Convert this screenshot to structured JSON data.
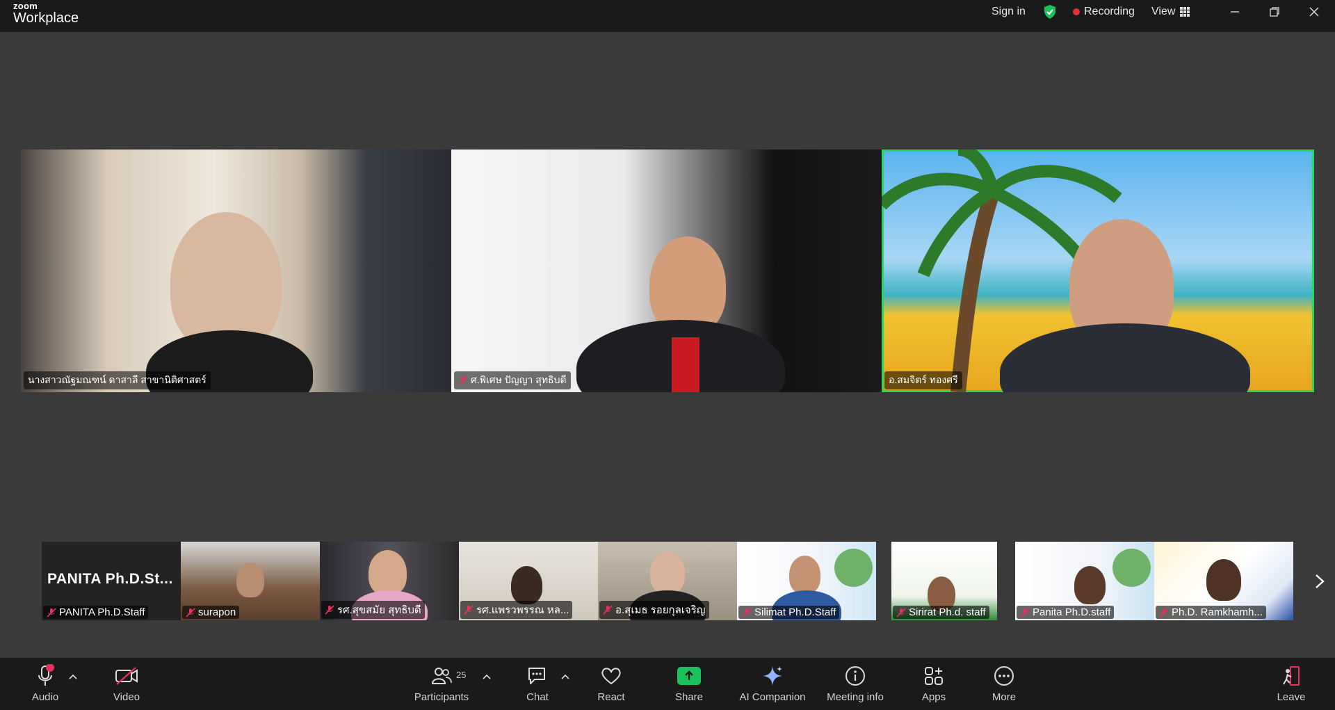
{
  "titlebar": {
    "brand_small": "zoom",
    "brand_big": "Workplace",
    "sign_in": "Sign in",
    "recording": "Recording",
    "view": "View"
  },
  "main_tiles": [
    {
      "name": "นางสาวณัฐมณฑน์ ดาสาลี สาขานิติศาสตร์",
      "muted": false
    },
    {
      "name": "ศ.พิเศษ ปัญญา สุทธิบดี",
      "muted": true
    },
    {
      "name": "อ.สมจิตร์ ทองศรี",
      "muted": false,
      "speaking": true
    }
  ],
  "filmstrip": [
    {
      "name": "PANITA Ph.D.Staff",
      "display_name": "PANITA Ph.D.St..."
    },
    {
      "name": "surapon"
    },
    {
      "name": "รศ.สุขสมัย สุทธิบดี"
    },
    {
      "name": "รศ.แพรวพรรณ หล..."
    },
    {
      "name": "อ.สุเมธ รอยกุลเจริญ"
    },
    {
      "name": "Silimat Ph.D.Staff"
    },
    {
      "name": "Sirirat Ph.d. staff"
    },
    {
      "name": "Panita Ph.D.staff"
    },
    {
      "name": "Ph.D. Ramkhamh..."
    }
  ],
  "toolbar": {
    "audio": "Audio",
    "video": "Video",
    "participants": "Participants",
    "participants_count": "25",
    "chat": "Chat",
    "react": "React",
    "share": "Share",
    "ai_companion": "AI Companion",
    "meeting_info": "Meeting info",
    "apps": "Apps",
    "more": "More",
    "leave": "Leave"
  },
  "colors": {
    "speaking_border": "#23d95f",
    "recording_dot": "#e0303b",
    "share_green": "#1bc25c",
    "shield_green": "#1bc25c",
    "audio_badge": "#e8305a"
  }
}
